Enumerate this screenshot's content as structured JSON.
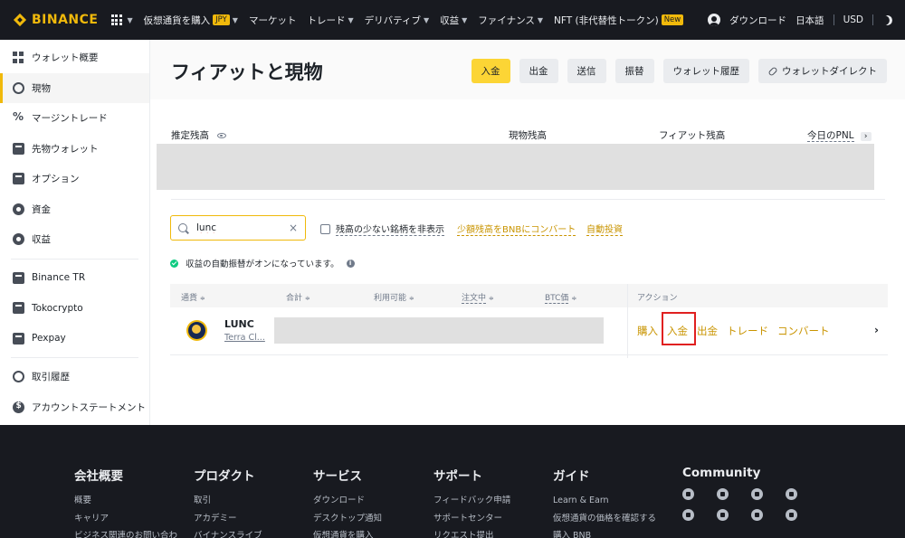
{
  "topnav": {
    "logo": "BINANCE",
    "items": [
      {
        "label": "仮想通貨を購入",
        "badge": "JPY",
        "caret": true
      },
      {
        "label": "マーケット",
        "caret": false
      },
      {
        "label": "トレード",
        "caret": true
      },
      {
        "label": "デリバティブ",
        "caret": true
      },
      {
        "label": "収益",
        "caret": true
      },
      {
        "label": "ファイナンス",
        "caret": true
      },
      {
        "label": "NFT (非代替性トークン)",
        "badge": "New",
        "caret": false
      }
    ],
    "download": "ダウンロード",
    "language": "日本語",
    "currency": "USD"
  },
  "sidebar": {
    "items": [
      {
        "label": "ウォレット概要",
        "icon": "dashboard-icon",
        "active": false
      },
      {
        "label": "現物",
        "icon": "spot-icon",
        "active": true
      },
      {
        "label": "マージントレード",
        "icon": "margin-icon",
        "active": false
      },
      {
        "label": "先物ウォレット",
        "icon": "futures-icon",
        "active": false
      },
      {
        "label": "オプション",
        "icon": "options-icon",
        "active": false
      },
      {
        "label": "資金",
        "icon": "funding-icon",
        "active": false
      },
      {
        "label": "収益",
        "icon": "earn-icon",
        "active": false
      }
    ],
    "items2": [
      {
        "label": "Binance TR",
        "icon": "binance-tr-icon"
      },
      {
        "label": "Tokocrypto",
        "icon": "tokocrypto-icon"
      },
      {
        "label": "Pexpay",
        "icon": "pexpay-icon"
      }
    ],
    "items3": [
      {
        "label": "取引履歴",
        "icon": "history-icon"
      },
      {
        "label": "アカウントステートメント",
        "icon": "statement-icon"
      }
    ]
  },
  "main": {
    "title": "フィアットと現物",
    "actions": {
      "deposit": "入金",
      "withdraw": "出金",
      "send": "送信",
      "convert": "振替",
      "history": "ウォレット履歴",
      "direct": "ウォレットダイレクト"
    },
    "balance": {
      "estimated": "推定残高",
      "spot": "現物残高",
      "fiat": "フィアット残高",
      "pnl": "今日のPNL",
      "pnl_arrow": "›"
    },
    "search": {
      "value": "lunc",
      "clear": "×"
    },
    "hide_small_label": "残高の少ない銘柄を非表示",
    "convert_small_link": "少額残高をBNBにコンバート",
    "auto_invest_link": "自動投資",
    "notice": "収益の自動振替がオンになっています。",
    "info": "i",
    "table": {
      "headers": {
        "coin": "通貨",
        "total": "合計",
        "available": "利用可能",
        "in_order": "注文中",
        "btc_value": "BTC価",
        "action": "アクション"
      },
      "sort_glyph": "≑",
      "rows": [
        {
          "symbol": "LUNC",
          "name": "Terra Cl...",
          "actions": {
            "buy": "購入",
            "deposit": "入金",
            "withdraw": "出金",
            "trade": "トレード",
            "convert": "コンバート"
          },
          "chevron": "›"
        }
      ]
    }
  },
  "footer": {
    "columns": [
      {
        "title": "会社概要",
        "links": [
          "概要",
          "キャリア",
          "ビジネス関連のお問い合わ"
        ]
      },
      {
        "title": "プロダクト",
        "links": [
          "取引",
          "アカデミー",
          "バイナンスライブ"
        ]
      },
      {
        "title": "サービス",
        "links": [
          "ダウンロード",
          "デスクトップ通知",
          "仮想通貨を購入"
        ]
      },
      {
        "title": "サポート",
        "links": [
          "フィードバック申請",
          "サポートセンター",
          "リクエスト提出"
        ]
      },
      {
        "title": "ガイド",
        "links": [
          "Learn & Earn",
          "仮想通貨の価格を確認する",
          "購入 BNB"
        ]
      }
    ],
    "community": {
      "title": "Community",
      "icons": [
        "discord-icon",
        "telegram-icon",
        "tiktok-icon",
        "facebook-icon",
        "twitter-icon",
        "reddit-icon",
        "instagram-icon",
        "coinmarketcap-icon"
      ]
    }
  },
  "colors": {
    "accent": "#f0b90b",
    "dark": "#181a20",
    "link": "#c99400",
    "highlight": "#e02020"
  }
}
